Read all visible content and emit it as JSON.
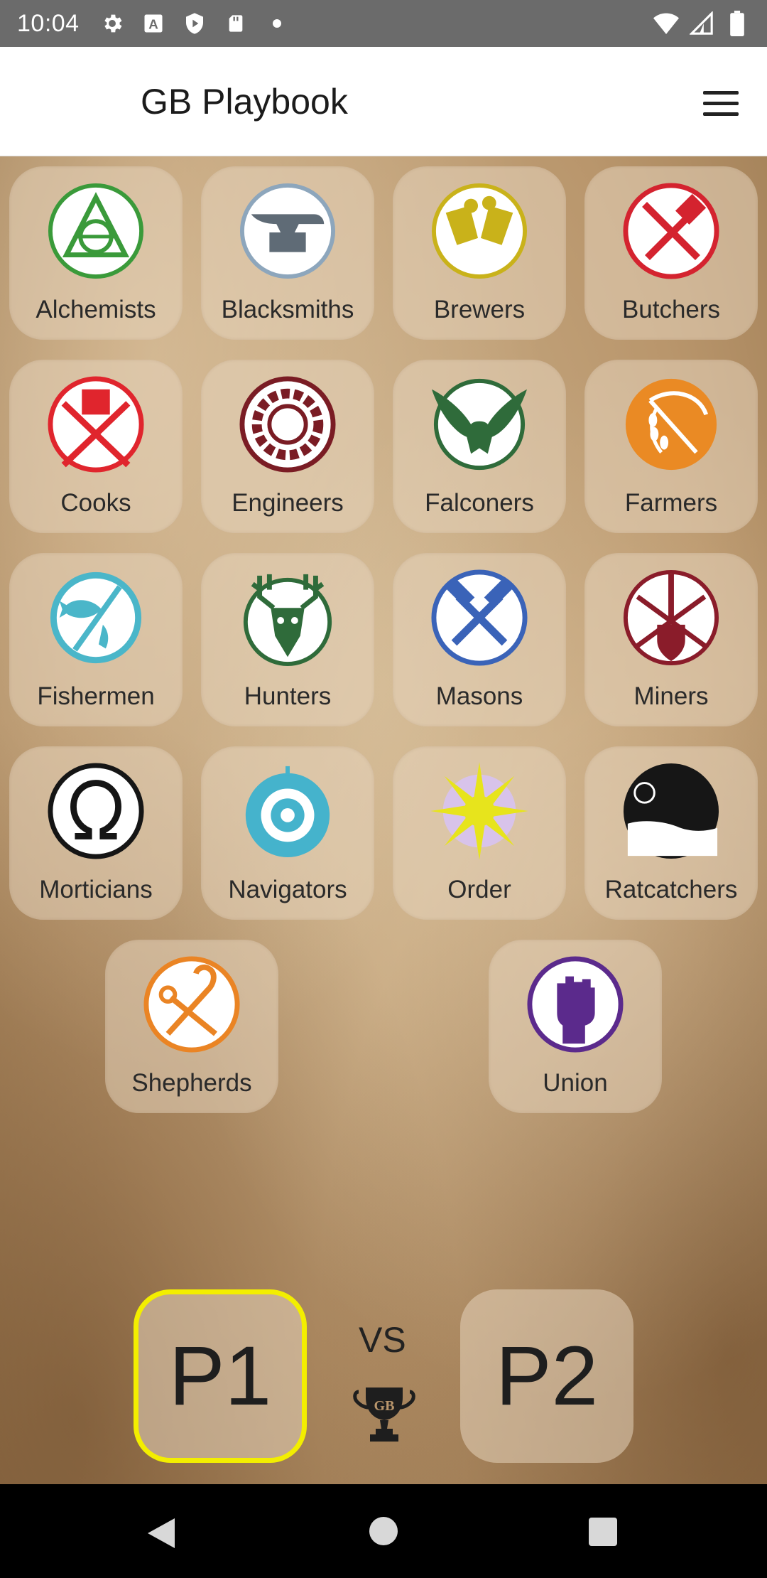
{
  "status_bar": {
    "time": "10:04",
    "left_icons": [
      "settings-icon",
      "a-box-icon",
      "shield-icon",
      "sd-card-icon",
      "dot-icon"
    ],
    "right_icons": [
      "wifi-icon",
      "signal-icon",
      "battery-icon"
    ]
  },
  "app_bar": {
    "title": "GB Playbook",
    "menu_icon": "hamburger-menu-icon"
  },
  "guilds": [
    {
      "label": "Alchemists",
      "icon": "alchemists-icon",
      "color": "#3a9a3a"
    },
    {
      "label": "Blacksmiths",
      "icon": "anvil-icon",
      "color": "#8da6bc"
    },
    {
      "label": "Brewers",
      "icon": "beer-mugs-icon",
      "color": "#c9b21a"
    },
    {
      "label": "Butchers",
      "icon": "cleaver-icon",
      "color": "#d4232f"
    },
    {
      "label": "Cooks",
      "icon": "chef-hat-icon",
      "color": "#e0252d"
    },
    {
      "label": "Engineers",
      "icon": "gear-icon",
      "color": "#7a1c24"
    },
    {
      "label": "Falconers",
      "icon": "falcon-icon",
      "color": "#2f6b3a"
    },
    {
      "label": "Farmers",
      "icon": "wheat-scythe-icon",
      "color": "#ea8a24"
    },
    {
      "label": "Fishermen",
      "icon": "fish-icon",
      "color": "#4ab6c9"
    },
    {
      "label": "Hunters",
      "icon": "stag-skull-icon",
      "color": "#2f6b3a"
    },
    {
      "label": "Masons",
      "icon": "crossed-hammers-icon",
      "color": "#3a63b8"
    },
    {
      "label": "Miners",
      "icon": "pick-shovel-icon",
      "color": "#8a1c2a"
    },
    {
      "label": "Morticians",
      "icon": "omega-icon",
      "color": "#151515"
    },
    {
      "label": "Navigators",
      "icon": "ship-wheel-icon",
      "color": "#45b3cc"
    },
    {
      "label": "Order",
      "icon": "sun-icon",
      "color": "#e7e41c"
    },
    {
      "label": "Ratcatchers",
      "icon": "rat-icon",
      "color": "#161616"
    },
    {
      "label": "Shepherds",
      "icon": "crook-shears-icon",
      "color": "#ea8424"
    },
    {
      "label": "Union",
      "icon": "raised-fist-icon",
      "color": "#5b2a8c"
    }
  ],
  "match": {
    "p1_label": "P1",
    "p2_label": "P2",
    "vs_label": "VS",
    "selected_player": "P1",
    "highlight_color": "#f3ee00",
    "logo_icon": "gb-trophy-logo-icon"
  },
  "nav_bar": {
    "back_icon": "back-triangle-icon",
    "home_icon": "home-circle-icon",
    "recents_icon": "recents-square-icon"
  }
}
